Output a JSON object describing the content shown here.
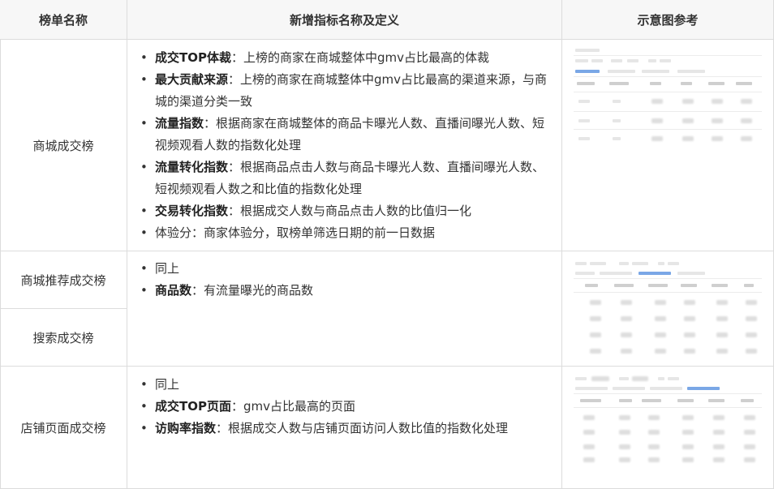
{
  "table": {
    "headers": [
      "榜单名称",
      "新增指标名称及定义",
      "示意图参考"
    ],
    "rows": [
      {
        "names": [
          "商城成交榜"
        ],
        "items": [
          {
            "term": "成交TOP体裁",
            "sep": "：",
            "desc": "上榜的商家在商城整体中gmv占比最高的体裁"
          },
          {
            "term": "最大贡献来源",
            "sep": "：",
            "desc": "上榜的商家在商城整体中gmv占比最高的渠道来源，与商城的渠道分类一致"
          },
          {
            "term": "流量指数",
            "sep": "：",
            "desc": "根据商家在商城整体的商品卡曝光人数、直播间曝光人数、短视频观看人数的指数化处理"
          },
          {
            "term": "流量转化指数",
            "sep": "：",
            "desc": "根据商品点击人数与商品卡曝光人数、直播间曝光人数、短视频观看人数之和比值的指数化处理"
          },
          {
            "term": "交易转化指数",
            "sep": "：",
            "desc": "根据成交人数与商品点击人数的比值归一化"
          },
          {
            "term": "",
            "sep": "",
            "desc": "体验分：商家体验分，取榜单筛选日期的前一日数据"
          }
        ]
      },
      {
        "names": [
          "商城推荐成交榜",
          "搜索成交榜"
        ],
        "items": [
          {
            "term": "",
            "sep": "",
            "desc": "同上"
          },
          {
            "term": "商品数",
            "sep": "：",
            "desc": "有流量曝光的商品数"
          }
        ]
      },
      {
        "names": [
          "店铺页面成交榜"
        ],
        "items": [
          {
            "term": "",
            "sep": "",
            "desc": "同上"
          },
          {
            "term": "成交TOP页面",
            "sep": "：",
            "desc": "gmv占比最高的页面"
          },
          {
            "term": "访购率指数",
            "sep": "：",
            "desc": "根据成交人数与店铺页面访问人数比值的指数化处理"
          }
        ]
      }
    ]
  },
  "colors": {
    "border": "#dcdcdc",
    "header_bg": "#f7f7f7",
    "accent": "#7aa7e6"
  }
}
